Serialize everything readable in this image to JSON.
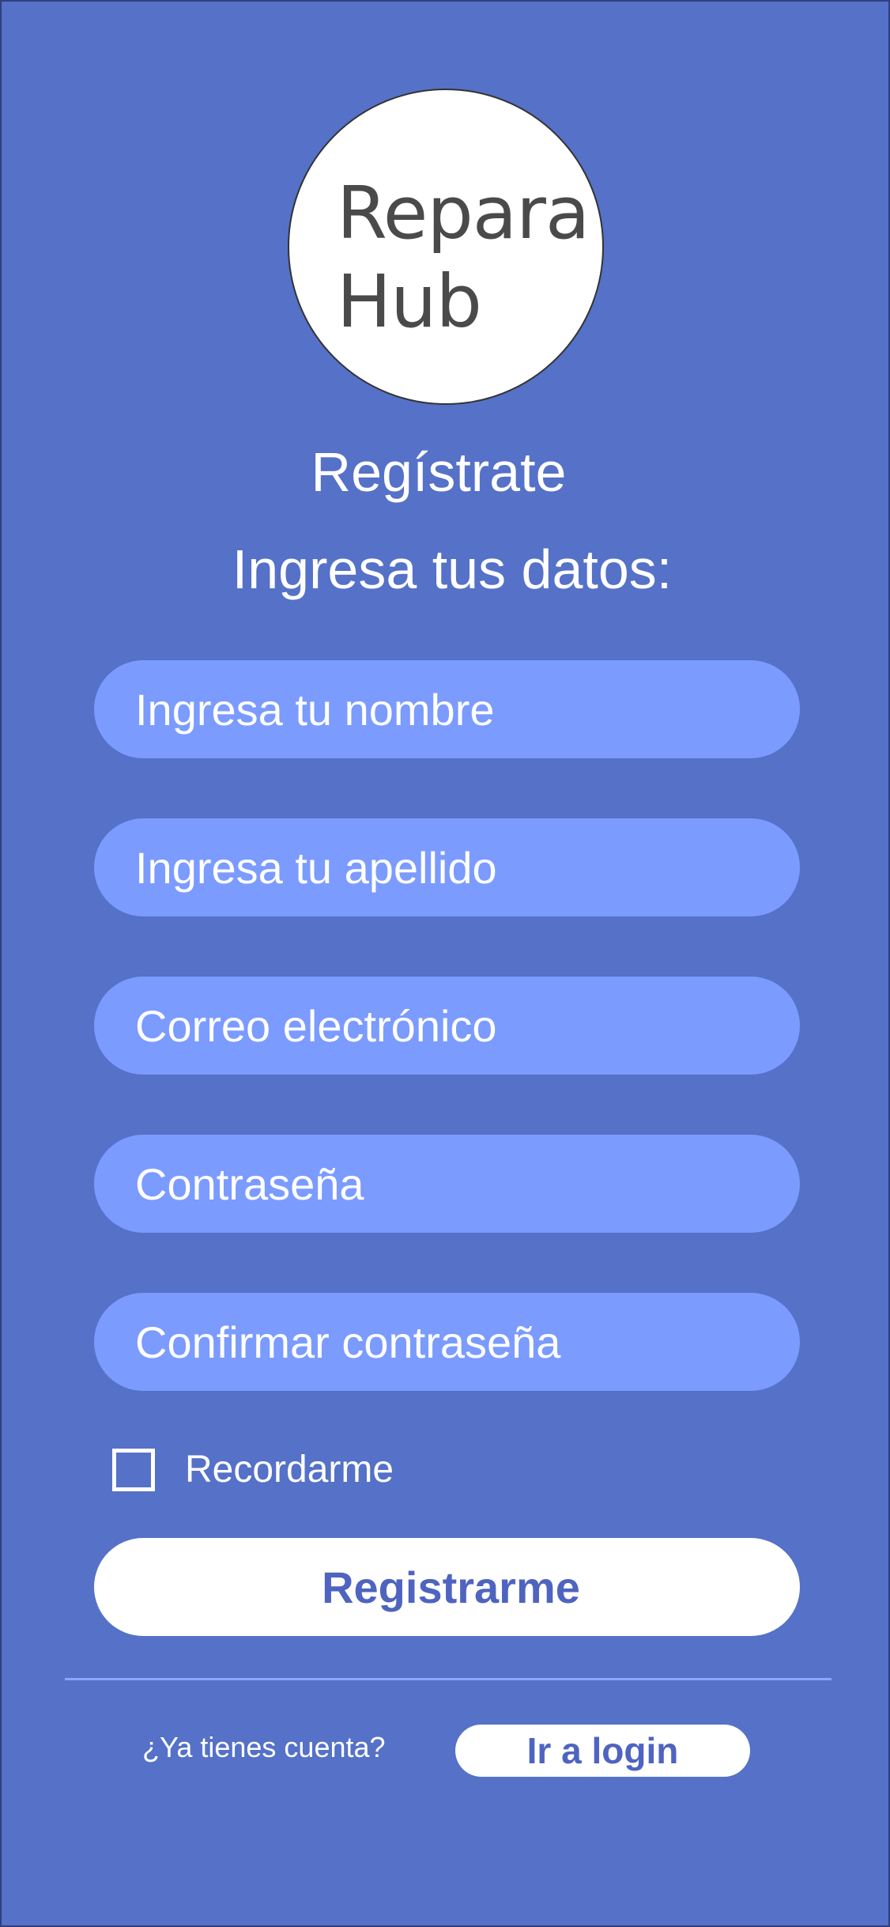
{
  "logo": {
    "line1": "Repara",
    "line2": "Hub"
  },
  "header": {
    "title": "Regístrate",
    "subtitle": "Ingresa tus datos:"
  },
  "form": {
    "first_name_placeholder": "Ingresa tu nombre",
    "last_name_placeholder": "Ingresa tu apellido",
    "email_placeholder": "Correo electrónico",
    "password_placeholder": "Contraseña",
    "confirm_password_placeholder": "Confirmar contraseña",
    "remember_label": "Recordarme",
    "remember_checked": false,
    "submit_label": "Registrarme"
  },
  "footer": {
    "question": "¿Ya tienes cuenta?",
    "login_label": "Ir a login"
  },
  "colors": {
    "background": "#5571c8",
    "field": "#7b9bff",
    "button": "#ffffff",
    "button_text": "#4f64c0"
  }
}
